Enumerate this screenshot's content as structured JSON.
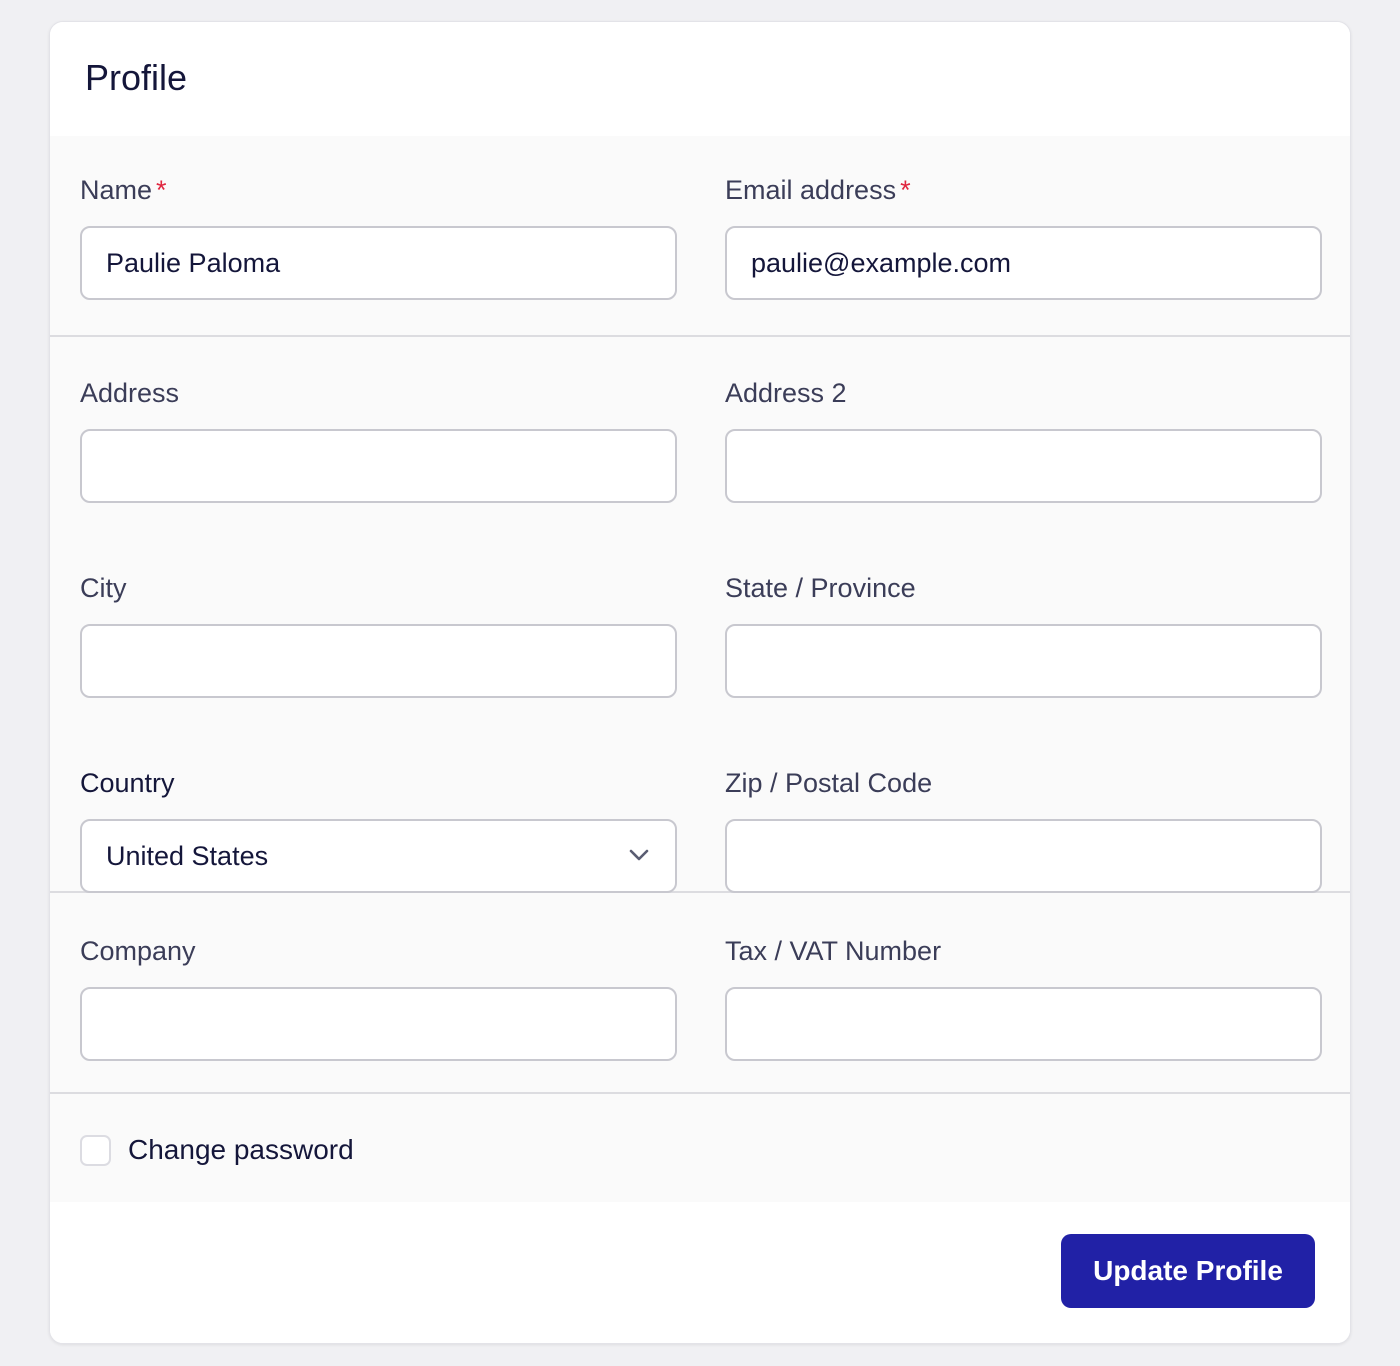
{
  "card": {
    "title": "Profile"
  },
  "fields": {
    "name": {
      "label": "Name",
      "required_mark": "*",
      "value": "Paulie Paloma",
      "placeholder": ""
    },
    "email": {
      "label": "Email address",
      "required_mark": "*",
      "value": "paulie@example.com",
      "placeholder": ""
    },
    "address": {
      "label": "Address",
      "value": "",
      "placeholder": ""
    },
    "address2": {
      "label": "Address 2",
      "value": "",
      "placeholder": ""
    },
    "city": {
      "label": "City",
      "value": "",
      "placeholder": ""
    },
    "state": {
      "label": "State / Province",
      "value": "",
      "placeholder": ""
    },
    "country": {
      "label": "Country",
      "selected": "United States",
      "icon": "chevron-down-icon"
    },
    "zip": {
      "label": "Zip / Postal Code",
      "value": "",
      "placeholder": ""
    },
    "company": {
      "label": "Company",
      "value": "",
      "placeholder": ""
    },
    "tax": {
      "label": "Tax / VAT Number",
      "value": "",
      "placeholder": ""
    }
  },
  "change_password": {
    "label": "Change password",
    "checked": false
  },
  "footer": {
    "submit_label": "Update Profile"
  },
  "colors": {
    "primary": "#2121a6",
    "required": "#e0263f",
    "text": "#14163a",
    "label": "#3b3d58"
  }
}
